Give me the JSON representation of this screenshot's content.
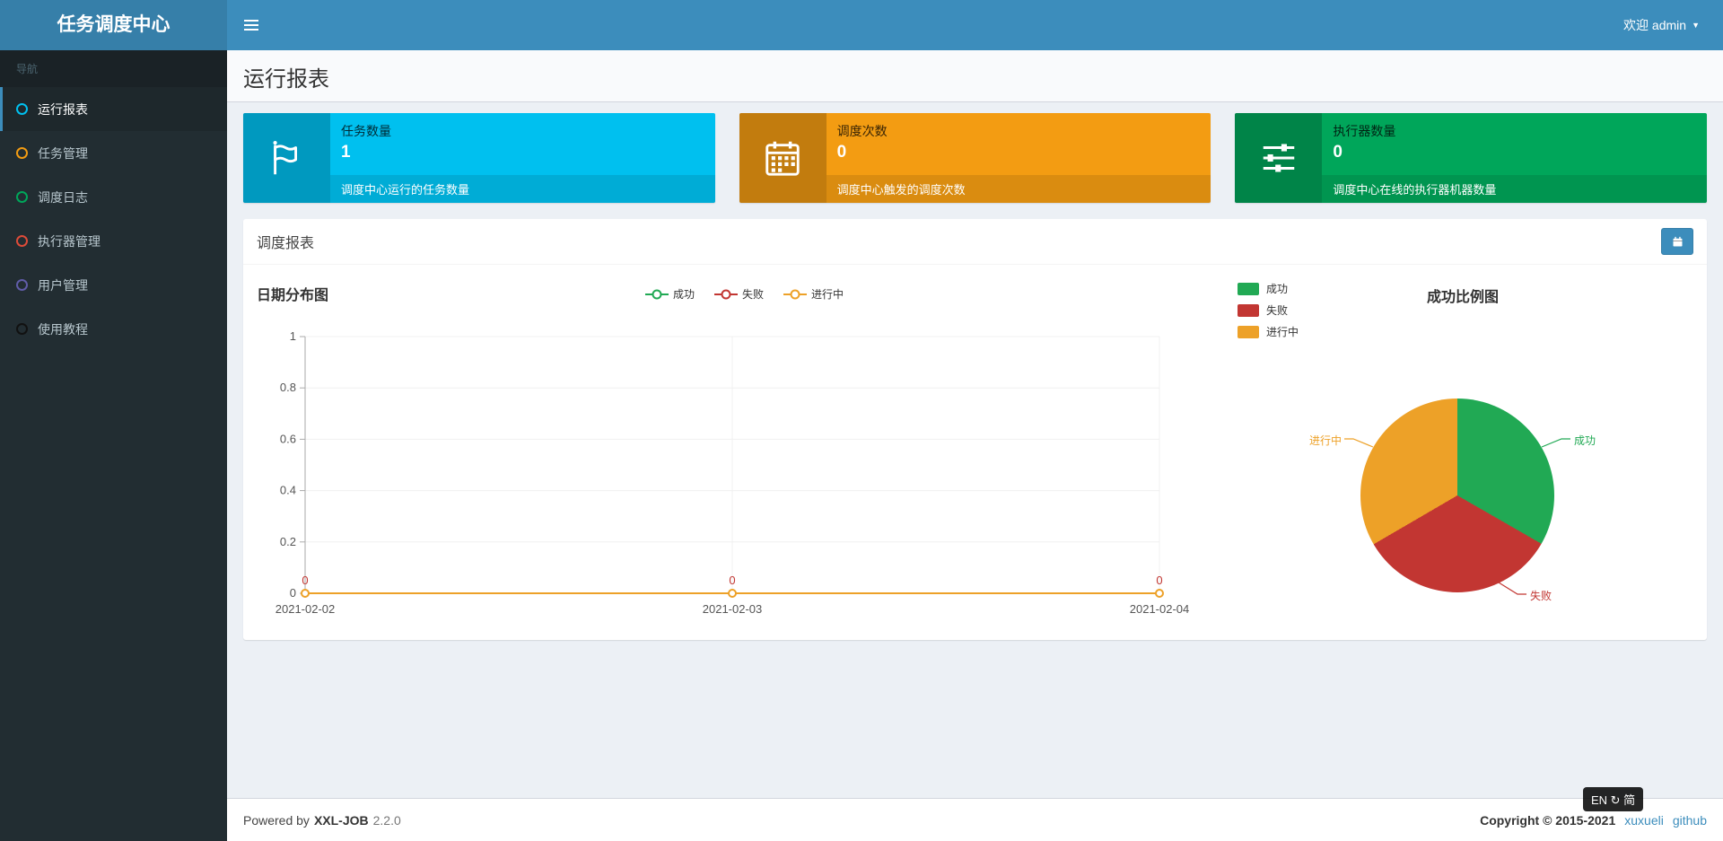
{
  "theme": {
    "accent": "#3c8dbc",
    "accent_dark": "#367fa9",
    "sidebar_bg": "#222d32",
    "content_bg": "#ecf0f5"
  },
  "header": {
    "app_title": "任务调度中心",
    "welcome": "欢迎 admin",
    "caret": "▼"
  },
  "sidebar": {
    "nav_label": "导航",
    "items": [
      {
        "label": "运行报表",
        "icon": "circle-outline-icon",
        "icon_color": "#00c0ef",
        "active": true
      },
      {
        "label": "任务管理",
        "icon": "circle-outline-icon",
        "icon_color": "#f39c12",
        "active": false
      },
      {
        "label": "调度日志",
        "icon": "circle-outline-icon",
        "icon_color": "#00a65a",
        "active": false
      },
      {
        "label": "执行器管理",
        "icon": "circle-outline-icon",
        "icon_color": "#dd4b39",
        "active": false
      },
      {
        "label": "用户管理",
        "icon": "circle-outline-icon",
        "icon_color": "#605ca8",
        "active": false
      },
      {
        "label": "使用教程",
        "icon": "circle-outline-icon",
        "icon_color": "#111111",
        "active": false
      }
    ]
  },
  "page": {
    "title": "运行报表"
  },
  "info_boxes": [
    {
      "title": "任务数量",
      "value": "1",
      "desc": "调度中心运行的任务数量",
      "color": "#00c0ef",
      "icon": "flag-icon"
    },
    {
      "title": "调度次数",
      "value": "0",
      "desc": "调度中心触发的调度次数",
      "color": "#f39c12",
      "icon": "calendar-icon"
    },
    {
      "title": "执行器数量",
      "value": "0",
      "desc": "调度中心在线的执行器机器数量",
      "color": "#00a65a",
      "icon": "sliders-icon"
    }
  ],
  "panel": {
    "title": "调度报表"
  },
  "chart_data": [
    {
      "type": "line",
      "title": "日期分布图",
      "x": [
        "2021-02-02",
        "2021-02-03",
        "2021-02-04"
      ],
      "series": [
        {
          "name": "成功",
          "color": "#21a954",
          "values": [
            0,
            0,
            0
          ]
        },
        {
          "name": "失败",
          "color": "#c23632",
          "values": [
            0,
            0,
            0
          ]
        },
        {
          "name": "进行中",
          "color": "#eda128",
          "values": [
            0,
            0,
            0
          ]
        }
      ],
      "ylim": [
        0,
        1
      ],
      "yticks": [
        0,
        0.2,
        0.4,
        0.6,
        0.8,
        1
      ],
      "grid": true,
      "legend_position": "top-center"
    },
    {
      "type": "pie",
      "title": "成功比例图",
      "slices": [
        {
          "name": "成功",
          "color": "#21a954",
          "value": 33.3
        },
        {
          "name": "失败",
          "color": "#c23632",
          "value": 33.3
        },
        {
          "name": "进行中",
          "color": "#eda128",
          "value": 33.4
        }
      ],
      "legend_position": "top-left"
    }
  ],
  "footer": {
    "powered_prefix": "Powered by",
    "brand": "XXL-JOB",
    "version": "2.2.0",
    "copyright": "Copyright © 2015-2021",
    "links": [
      "xuxueli",
      "github"
    ]
  },
  "ime_badge": {
    "text": "EN ↻ 简"
  }
}
